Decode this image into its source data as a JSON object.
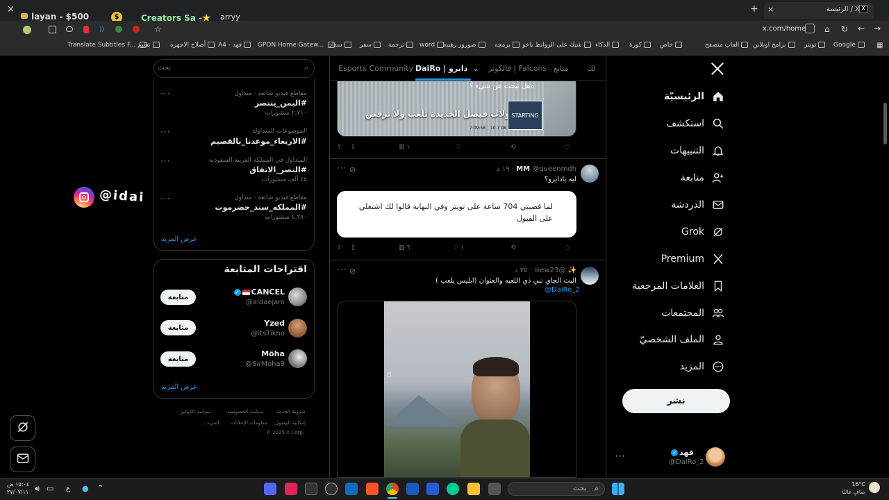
{
  "browser": {
    "tab_title": "الرئيسة / X",
    "overlay_name": "layan - $500",
    "overlay_name2": "Creators Sa -",
    "overlay_name3": "arryy",
    "url": "x.com/home",
    "new_tab_plus": "+",
    "close_x": "×",
    "bookmarks": [
      {
        "label": "Google"
      },
      {
        "label": "تويتر"
      },
      {
        "label": "برامج اونلاين"
      },
      {
        "label": "العاب متصفح"
      },
      {
        "label": "خاص"
      },
      {
        "label": "كورة"
      },
      {
        "label": "الذكاء"
      },
      {
        "label": "شيك على الروابط ياخو"
      },
      {
        "label": "برمجه"
      },
      {
        "label": "صورور رهيبه"
      },
      {
        "label": "word"
      },
      {
        "label": "ترجمة"
      },
      {
        "label": "سفر"
      },
      {
        "label": "سداد"
      },
      {
        "label": "GPON Home Gatew..."
      },
      {
        "label": "فهد - A4"
      },
      {
        "label": "أصلاح الاجهزه"
      },
      {
        "label": "تعليم"
      },
      {
        "label": "Translate Subtitles F..."
      }
    ]
  },
  "nav": {
    "items": [
      {
        "label": "الرئيسيّة",
        "icon": "home-icon"
      },
      {
        "label": "استكشف",
        "icon": "search-icon"
      },
      {
        "label": "التنبيهات",
        "icon": "bell-icon"
      },
      {
        "label": "متابعة",
        "icon": "add-user-icon"
      },
      {
        "label": "الدردشة",
        "icon": "mail-icon"
      },
      {
        "label": "Grok",
        "icon": "grok-icon"
      },
      {
        "label": "Premium",
        "icon": "x-logo-icon"
      },
      {
        "label": "العلامات المرجعية",
        "icon": "bookmark-icon"
      },
      {
        "label": "المجتمعات",
        "icon": "communities-icon"
      },
      {
        "label": "الملف الشخصيّ",
        "icon": "profile-icon"
      },
      {
        "label": "المزيد",
        "icon": "more-icon"
      }
    ],
    "post_button": "نشر",
    "account": {
      "name": "فهد",
      "handle": "@DaiRo_2"
    }
  },
  "tabs": [
    {
      "label": "لك"
    },
    {
      "label": "متابع"
    },
    {
      "label": "فالكونز | Falcons"
    },
    {
      "label": "DaiRo | دايرو"
    },
    {
      "label": "Esports Community"
    }
  ],
  "tweets": {
    "first": {
      "image_search_text": "هل تبحث عن شيء ؟",
      "image_caption": "من مقولات فيصل الجديدة تلعب ولا ترقص",
      "image_stats_a": "10.7 08",
      "image_stats_b": "7:09:58",
      "views": "١"
    },
    "second": {
      "name": "MM",
      "handle": "@queenmdh",
      "time": "١٩ د",
      "text": "ليه يادايرو؟",
      "quote_text": "لما قضيتي 704 ساعة على تويتر وفي النهاية قالوا لك اشتغلي على القبول",
      "views": "٦",
      "likes": "١"
    },
    "third": {
      "name": "✨",
      "handle": "@iiiew23",
      "time": "٣٥ د",
      "text": "البث الجاي نبي ذي اللعبه والعنوان (ابليس يلعب )",
      "mention": "@DaiRo_2"
    }
  },
  "search": {
    "placeholder": "بحث"
  },
  "trends": [
    {
      "context": "مقاطع فيديو شائعة · متداول",
      "name": "#اليمن_ينتصر",
      "count": "٢,٧١٠ منشورات"
    },
    {
      "context": "الموضوعات المتداولة",
      "name": "#الاربعاء_موعدنا_بالقصيم",
      "count": ""
    },
    {
      "context": "المتداول في المملكة العربية السعودية",
      "name": "#النصر_الاتفاق",
      "count": "٤٥ ألف منشورات"
    },
    {
      "context": "مقاطع فيديو شائعة · متداول",
      "name": "#المملكه_سند_حضرموت",
      "count": "٤,٢٨٠ منشورات"
    }
  ],
  "show_more": "عرض المزيد",
  "suggestions": {
    "title": "اقتراحات المتابعة",
    "users": [
      {
        "name": "CANCEL",
        "handle": "@aldaejam",
        "button": "متابعة"
      },
      {
        "name": "Yzed",
        "handle": "@itsTikno",
        "button": "متابعة"
      },
      {
        "name": "Möha",
        "handle": "@SirMoha9",
        "button": "متابعة"
      }
    ],
    "show_more": "عرض المزيد"
  },
  "footer": {
    "links": [
      "شروط الخدمة",
      "سياسة الخصوصية",
      "سياسة الكوكيز",
      "إمكانية الوصول",
      "معلومات الإعلانات",
      "المزيد ..."
    ],
    "copyright": "© 2025 X Corp."
  },
  "overlay": {
    "instagram": "@idai"
  },
  "taskbar": {
    "search": "بحث",
    "weather_temp": "16°C",
    "weather_desc": "صافٍ غالبًا",
    "time": "١٥:٠٤ ص",
    "date": "٢٧/٠٧/١١",
    "lang": "ع"
  },
  "colors": {
    "accent": "#1d9bf0",
    "bg": "#000000",
    "border": "#2f3336",
    "muted": "#71767b"
  }
}
